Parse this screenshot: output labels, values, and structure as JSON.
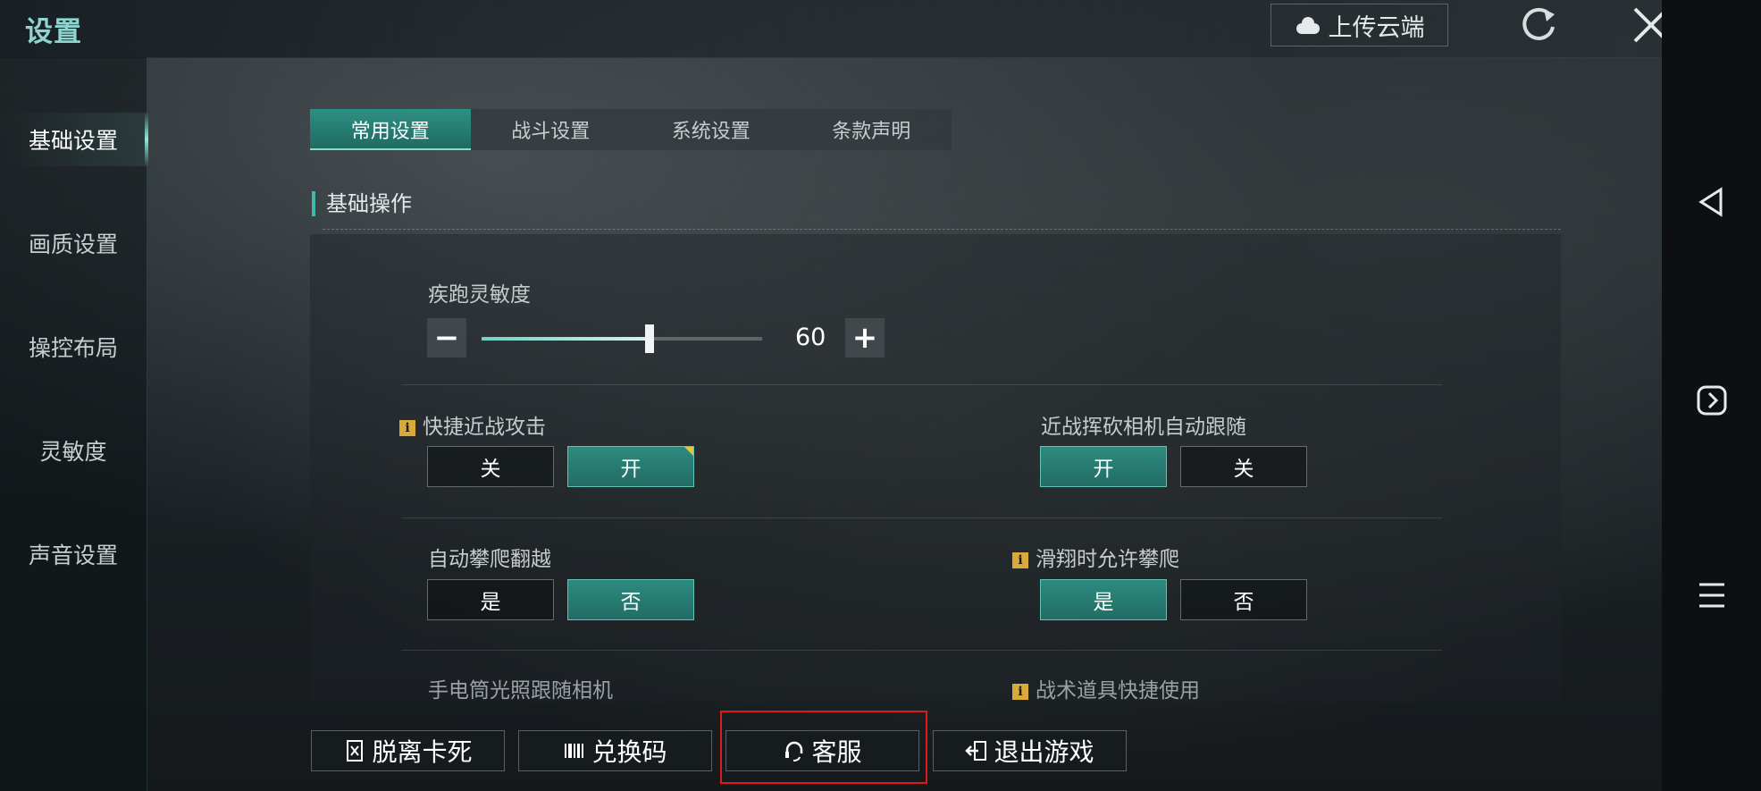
{
  "header": {
    "title": "设置",
    "upload_label": "上传云端"
  },
  "sidebar": {
    "items": [
      {
        "label": "基础设置",
        "active": true
      },
      {
        "label": "画质设置",
        "active": false
      },
      {
        "label": "操控布局",
        "active": false
      },
      {
        "label": "灵敏度",
        "active": false
      },
      {
        "label": "声音设置",
        "active": false
      }
    ]
  },
  "tabs": [
    {
      "label": "常用设置",
      "active": true
    },
    {
      "label": "战斗设置",
      "active": false
    },
    {
      "label": "系统设置",
      "active": false
    },
    {
      "label": "条款声明",
      "active": false
    }
  ],
  "section": {
    "title": "基础操作"
  },
  "sprint_sensitivity": {
    "label": "疾跑灵敏度",
    "value": "60",
    "minus": "−",
    "plus": "+",
    "fill_fraction": 0.6
  },
  "settings": {
    "quick_melee": {
      "label": "快捷近战攻击",
      "off": "关",
      "on": "开",
      "selected": "开"
    },
    "melee_camera_follow": {
      "label": "近战挥砍相机自动跟随",
      "on": "开",
      "off": "关",
      "selected": "开"
    },
    "auto_climb": {
      "label": "自动攀爬翻越",
      "yes": "是",
      "no": "否",
      "selected": "否"
    },
    "glide_climb": {
      "label": "滑翔时允许攀爬",
      "yes": "是",
      "no": "否",
      "selected": "是"
    },
    "flashlight_follow": {
      "label": "手电筒光照跟随相机"
    },
    "tactical_quick_use": {
      "label": "战术道具快捷使用"
    }
  },
  "info_glyph": "i",
  "bottom_buttons": {
    "unstuck": "脱离卡死",
    "redeem": "兑换码",
    "support": "客服",
    "exit": "退出游戏"
  },
  "colors": {
    "accent": "#2d8a7f",
    "title": "#8ed4cf",
    "highlight": "#e01a1a"
  }
}
